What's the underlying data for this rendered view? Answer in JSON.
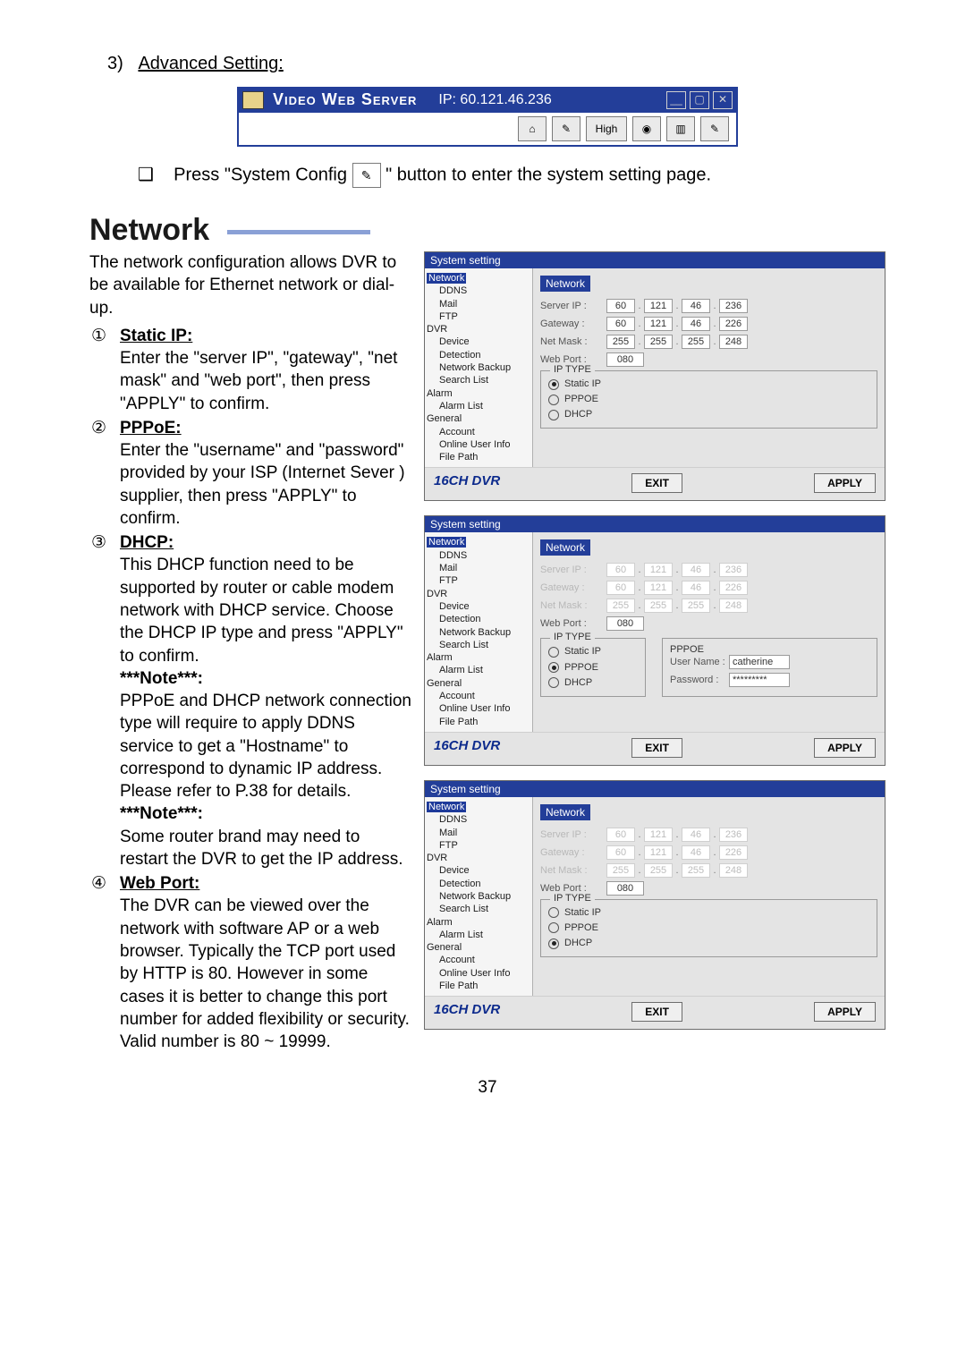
{
  "step3": {
    "num": "3)",
    "label": "Advanced Setting:"
  },
  "titlebar": {
    "appname": "Video Web Server",
    "ip_label": "IP:",
    "ip_value": "60.121.46.236",
    "min": "__",
    "restore": "▢",
    "close": "✕"
  },
  "toolbar": {
    "b1": "⌂",
    "b2": "✎",
    "high": "High",
    "b4": "◉",
    "b5": "▥",
    "config": "✎"
  },
  "press_line": {
    "pre": "Press \"System Config ",
    "post": " \" button to enter the system setting page.",
    "bullet": "❑"
  },
  "heading": "Network",
  "intro": "The network configuration allows DVR to be available for Ethernet network or dial-up.",
  "items": {
    "one": {
      "marker": "①",
      "title": "Static IP:",
      "body": "Enter the \"server IP\", \"gateway\", \"net mask\" and \"web port\", then press \"APPLY\" to confirm."
    },
    "two": {
      "marker": "②",
      "title": "PPPoE:",
      "body": "Enter the \"username\" and \"password\" provided by your ISP (Internet Sever ) supplier, then press \"APPLY\" to confirm."
    },
    "three": {
      "marker": "③",
      "title": "DHCP:",
      "body1": "This DHCP function need to be supported by router or cable modem network with DHCP service. Choose the DHCP IP type and press \"APPLY\" to confirm.",
      "note1_label": "***Note***:",
      "note1_body": "PPPoE and DHCP network connection type will require to apply DDNS service to get a \"Hostname\" to correspond to dynamic IP address.\nPlease refer to P.38 for details.",
      "note2_label": "***Note***:",
      "note2_body": "Some router brand may need to restart the DVR to get the IP address."
    },
    "four": {
      "marker": "④",
      "title": "Web Port:",
      "body": "The DVR can be viewed over the network with software AP or a web browser. Typically the TCP port used by HTTP is 80. However in some cases it is better to change this port number for added flexibility or security. Valid number is 80 ~ 19999."
    }
  },
  "syswin_common": {
    "title": "System setting",
    "panel_title": "Network",
    "labels": {
      "server_ip": "Server IP :",
      "gateway": "Gateway :",
      "netmask": "Net Mask :",
      "webport": "Web Port :",
      "iptype": "IP TYPE",
      "static": "Static IP",
      "pppoe": "PPPOE",
      "dhcp": "DHCP",
      "username": "User Name :",
      "password": "Password :"
    },
    "tree": [
      "Network",
      "DDNS",
      "Mail",
      "FTP",
      "DVR",
      "Device",
      "Detection",
      "Network Backup",
      "Search List",
      "Alarm",
      "Alarm List",
      "General",
      "Account",
      "Online User Info",
      "File Path"
    ],
    "brand": "16CH DVR",
    "exit": "EXIT",
    "apply": "APPLY",
    "webport_value": "080"
  },
  "panels": {
    "p1": {
      "server_ip": [
        "60",
        "121",
        "46",
        "236"
      ],
      "gateway": [
        "60",
        "121",
        "46",
        "226"
      ],
      "netmask": [
        "255",
        "255",
        "255",
        "248"
      ],
      "selected": "static"
    },
    "p2": {
      "server_ip": [
        "60",
        "121",
        "46",
        "236"
      ],
      "gateway": [
        "60",
        "121",
        "46",
        "226"
      ],
      "netmask": [
        "255",
        "255",
        "255",
        "248"
      ],
      "selected": "pppoe",
      "username": "catherine",
      "password": "*********"
    },
    "p3": {
      "server_ip": [
        "60",
        "121",
        "46",
        "236"
      ],
      "gateway": [
        "60",
        "121",
        "46",
        "226"
      ],
      "netmask": [
        "255",
        "255",
        "255",
        "248"
      ],
      "selected": "dhcp"
    }
  },
  "page_number": "37"
}
